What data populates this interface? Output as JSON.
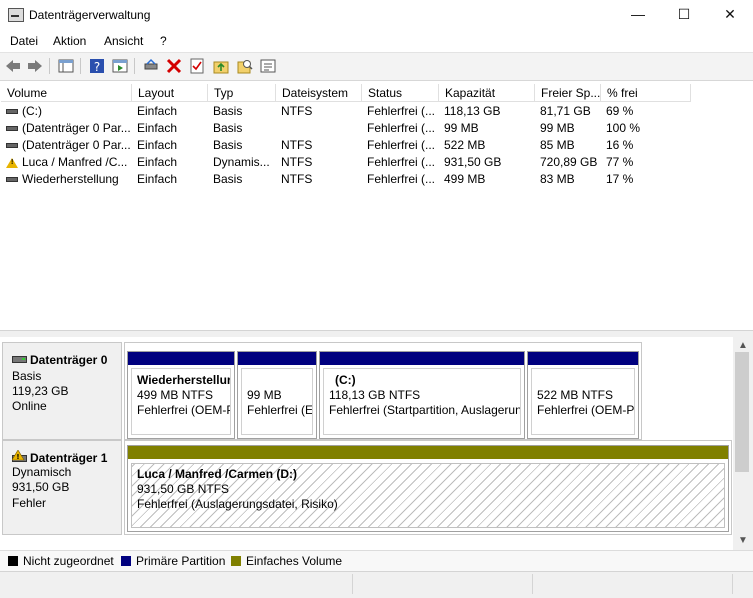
{
  "window": {
    "title": "Datenträgerverwaltung",
    "minimize": "—",
    "maximize": "☐",
    "close": "✕"
  },
  "menu": [
    "Datei",
    "Aktion",
    "Ansicht",
    "?"
  ],
  "columns": [
    "Volume",
    "Layout",
    "Typ",
    "Dateisystem",
    "Status",
    "Kapazität",
    "Freier Sp...",
    "% frei"
  ],
  "volumes": [
    {
      "icon": "drive-icon",
      "name": "(C:)",
      "layout": "Einfach",
      "typ": "Basis",
      "fs": "NTFS",
      "status": "Fehlerfrei (...",
      "cap": "118,13 GB",
      "free": "81,71 GB",
      "pct": "69 %"
    },
    {
      "icon": "drive-icon",
      "name": "(Datenträger 0 Par...",
      "layout": "Einfach",
      "typ": "Basis",
      "fs": "",
      "status": "Fehlerfrei (...",
      "cap": "99 MB",
      "free": "99 MB",
      "pct": "100 %"
    },
    {
      "icon": "drive-icon",
      "name": "(Datenträger 0 Par...",
      "layout": "Einfach",
      "typ": "Basis",
      "fs": "NTFS",
      "status": "Fehlerfrei (...",
      "cap": "522 MB",
      "free": "85 MB",
      "pct": "16 %"
    },
    {
      "icon": "warning-icon",
      "name": "Luca / Manfred /C...",
      "layout": "Einfach",
      "typ": "Dynamis...",
      "fs": "NTFS",
      "status": "Fehlerfrei (...",
      "cap": "931,50 GB",
      "free": "720,89 GB",
      "pct": "77 %"
    },
    {
      "icon": "drive-icon",
      "name": "Wiederherstellung",
      "layout": "Einfach",
      "typ": "Basis",
      "fs": "NTFS",
      "status": "Fehlerfrei (...",
      "cap": "499 MB",
      "free": "83 MB",
      "pct": "17 %"
    }
  ],
  "disks": [
    {
      "name": "Datenträger 0",
      "type": "Basis",
      "size": "119,23 GB",
      "state": "Online",
      "partitions": [
        {
          "title": "Wiederherstellur",
          "line1": "499 MB NTFS",
          "line2": "Fehlerfrei (OEM-P"
        },
        {
          "title": "",
          "line1": "99 MB",
          "line2": "Fehlerfrei (EF"
        },
        {
          "title": "(C:)",
          "line1": "118,13 GB NTFS",
          "line2": "Fehlerfrei (Startpartition, Auslagerun"
        },
        {
          "title": "",
          "line1": "522 MB NTFS",
          "line2": "Fehlerfrei (OEM-Pa"
        }
      ]
    },
    {
      "name": "Datenträger 1",
      "type": "Dynamisch",
      "size": "931,50 GB",
      "state": "Fehler",
      "partitions": [
        {
          "title": "Luca / Manfred /Carmen  (D:)",
          "line1": "931,50 GB NTFS",
          "line2": "Fehlerfrei (Auslagerungsdatei, Risiko)"
        }
      ]
    }
  ],
  "legend": [
    {
      "label": "Nicht zugeordnet",
      "color": "#000000"
    },
    {
      "label": "Primäre Partition",
      "color": "#00007f"
    },
    {
      "label": "Einfaches Volume",
      "color": "#808000"
    }
  ],
  "colors": {
    "primary": "#00007f",
    "simple": "#808000",
    "warning": "#e8b400"
  }
}
